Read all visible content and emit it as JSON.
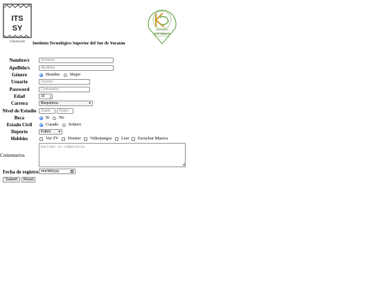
{
  "header": {
    "logo_text_1": "ITS",
    "logo_text_2": "SY",
    "logo_sub": "Oxkutzcab",
    "institution": "Instituto Tecnológico Superior del Sur de Yucatán",
    "logo2_text_1": "INGENIERÍA",
    "logo2_text_2": "SISTEMAS"
  },
  "form": {
    "nombre": {
      "label": "Nombre/s",
      "placeholder": "Nombres"
    },
    "apellido": {
      "label": "Apellido/s",
      "placeholder": "Apellidos"
    },
    "genero": {
      "label": "Género",
      "options": [
        "Hombre",
        "Mujer"
      ],
      "selected": "Hombre"
    },
    "usuario": {
      "label": "Usuario",
      "placeholder": "Usuario"
    },
    "password": {
      "label": "Password",
      "placeholder": "Contraseña"
    },
    "edad": {
      "label": "Edad",
      "value": "16"
    },
    "carrera": {
      "label": "Carrera",
      "value": "Bioquímica"
    },
    "nivel": {
      "label": "Nivel de Estudio",
      "placeholder_grado": "Grado",
      "placeholder_grupo": "Grupo"
    },
    "beca": {
      "label": "Beca",
      "options": [
        "Si",
        "No"
      ],
      "selected": "Si"
    },
    "estado_civil": {
      "label": "Estado Civil",
      "options": [
        "Casado",
        "Soltero"
      ],
      "selected": "Casado"
    },
    "deporte": {
      "label": "Deporte",
      "value": "Futbol"
    },
    "hobbies": {
      "label": "Hobbies",
      "options": [
        "Ver TV",
        "Dormir",
        "Videojuegos",
        "Leer",
        "Escuchar Musica"
      ]
    },
    "comentarios": {
      "label": "Comentarios",
      "placeholder": "Escribe tu comentario"
    },
    "fecha": {
      "label": "Fecha de registro",
      "placeholder": "mm/dd/yyyy"
    },
    "submit_label": "Submit",
    "reset_label": "Reset"
  },
  "colors": {
    "radio_accent": "#1a73e8",
    "logo_green": "#6aa84f"
  }
}
